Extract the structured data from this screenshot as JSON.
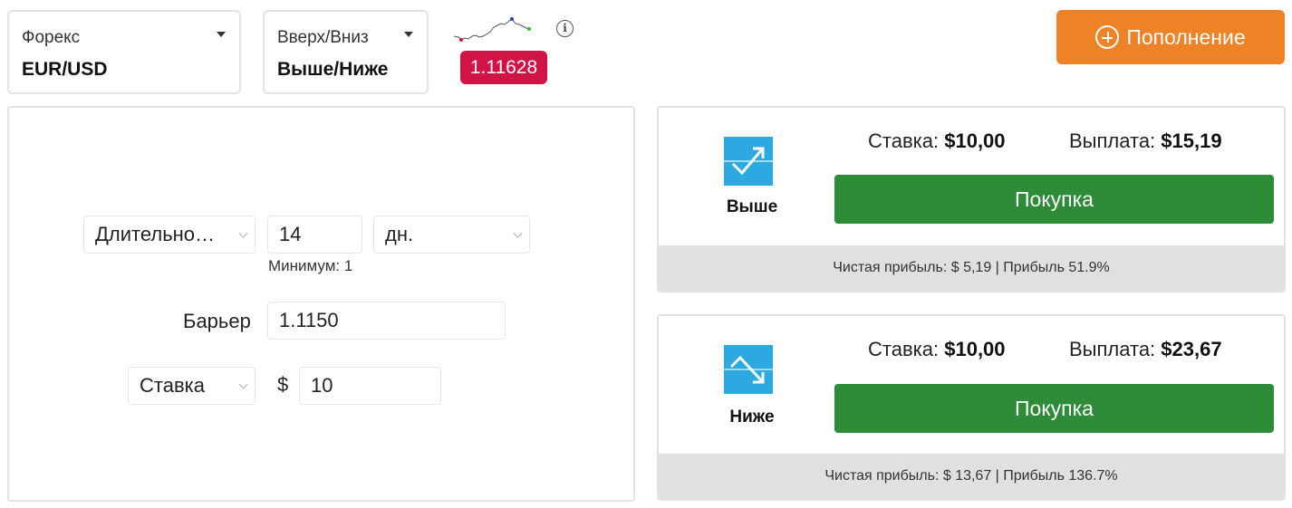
{
  "asset_selector": {
    "category": "Форекс",
    "value": "EUR/USD",
    "caret_icon": "caret-down-icon"
  },
  "type_selector": {
    "category": "Вверх/Вниз",
    "value": "Выше/Ниже",
    "caret_icon": "caret-down-icon"
  },
  "price": {
    "value": "1.11628",
    "badge_color": "#d01445",
    "sparkline_icon": "sparkline-chart-icon",
    "info_icon": "info-icon"
  },
  "deposit_button": {
    "label": "Пополнение",
    "icon": "plus-circle-icon",
    "color": "#ee8227"
  },
  "form": {
    "duration_select": "Длительно…",
    "duration_value": "14",
    "duration_unit": "дн.",
    "duration_hint": "Минимум: 1",
    "barrier_label": "Барьер",
    "barrier_value": "1.1150",
    "stake_select": "Ставка",
    "currency_symbol": "$",
    "stake_value": "10"
  },
  "contracts": [
    {
      "direction_label": "Выше",
      "icon": "arrow-up-trend-icon",
      "stake_label": "Ставка:",
      "stake_value": "$10,00",
      "payout_label": "Выплата:",
      "payout_value": "$15,19",
      "buy_label": "Покупка",
      "footer": "Чистая прибыль: $ 5,19 | Прибыль 51.9%"
    },
    {
      "direction_label": "Ниже",
      "icon": "arrow-down-trend-icon",
      "stake_label": "Ставка:",
      "stake_value": "$10,00",
      "payout_label": "Выплата:",
      "payout_value": "$23,67",
      "buy_label": "Покупка",
      "footer": "Чистая прибыль: $ 13,67 | Прибыль 136.7%"
    }
  ],
  "colors": {
    "buy_button": "#2e8b38",
    "contract_icon": "#2ca9e1",
    "footer_bg": "#e0e0e0"
  }
}
